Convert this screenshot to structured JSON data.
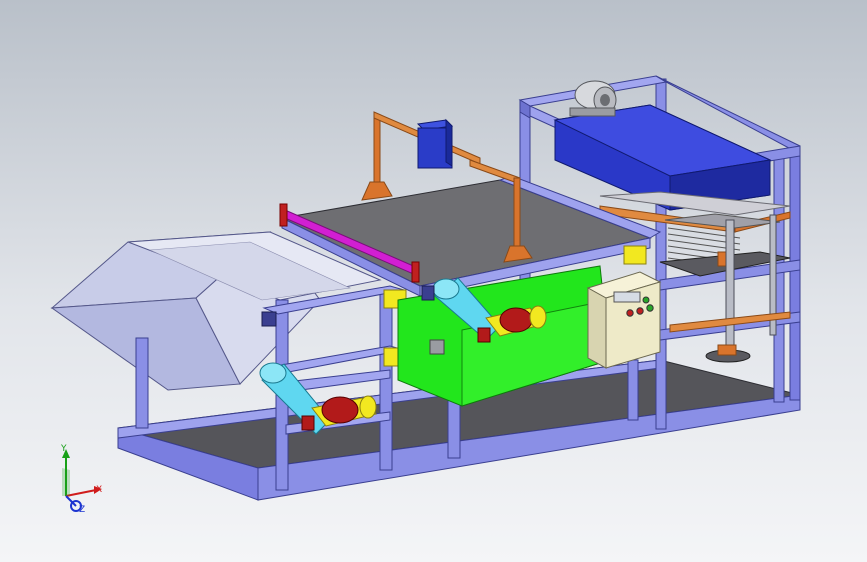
{
  "view": {
    "background_top": "#b9c0c9",
    "background_bottom": "#f4f5f7"
  },
  "colors": {
    "frame": "#8a8fe6",
    "frame_dark": "#4a4fa0",
    "belt_dark": "#6e6e72",
    "hopper": "#c8cce8",
    "panel_green": "#22e61c",
    "cyclone": "#5fd7f0",
    "motor_yellow": "#e8e04a",
    "motor_red": "#b21a1a",
    "blower_blue": "#2636c8",
    "orange_bracket": "#d9742c",
    "control_box": "#eeeac8",
    "magenta_bar": "#d21fd2"
  },
  "axes": {
    "x_label": "X",
    "y_label": "Y",
    "z_label": "Z",
    "x_color": "#d01c1c",
    "y_color": "#18a018",
    "z_color": "#1c34d0"
  }
}
